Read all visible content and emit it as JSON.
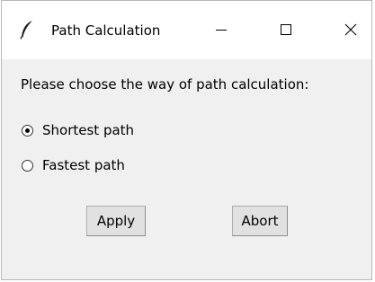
{
  "window": {
    "title": "Path Calculation",
    "app_icon": "feather-icon",
    "controls": {
      "minimize_icon": "minimize-icon",
      "maximize_icon": "maximize-icon",
      "close_icon": "close-icon"
    }
  },
  "form": {
    "prompt": "Please choose the way of path calculation:",
    "options": [
      {
        "label": "Shortest path",
        "selected": true
      },
      {
        "label": "Fastest path",
        "selected": false
      }
    ]
  },
  "buttons": {
    "apply_label": "Apply",
    "abort_label": "Abort"
  },
  "colors": {
    "window_background": "#f0f0f0",
    "titlebar_background": "#ffffff",
    "button_background": "#e1e1e1"
  }
}
